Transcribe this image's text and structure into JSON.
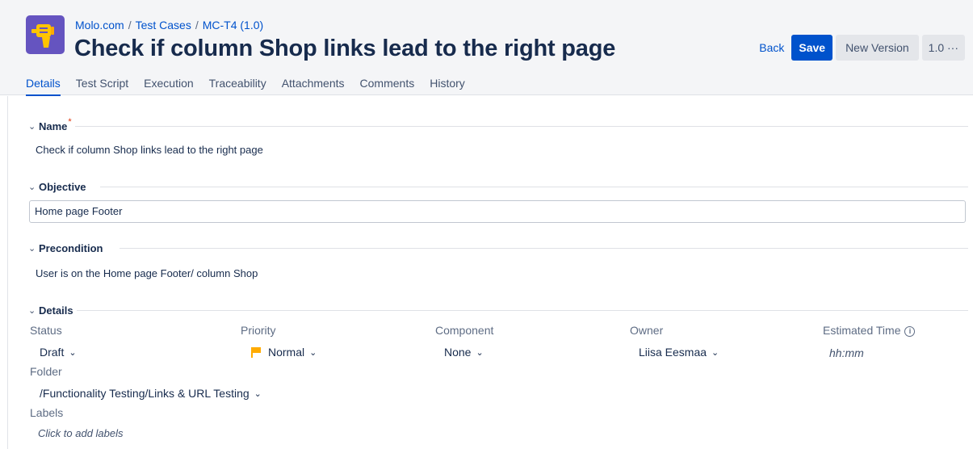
{
  "breadcrumb": {
    "project": "Molo.com",
    "section": "Test Cases",
    "key": "MC-T4 (1.0)",
    "separator": "/"
  },
  "page_title": "Check if column Shop links lead to the right page",
  "actions": {
    "back": "Back",
    "save": "Save",
    "new_version": "New Version",
    "version": "1.0 ···"
  },
  "tabs": [
    {
      "label": "Details",
      "active": true
    },
    {
      "label": "Test Script",
      "active": false
    },
    {
      "label": "Execution",
      "active": false
    },
    {
      "label": "Traceability",
      "active": false
    },
    {
      "label": "Attachments",
      "active": false
    },
    {
      "label": "Comments",
      "active": false
    },
    {
      "label": "History",
      "active": false
    }
  ],
  "sections": {
    "name": {
      "label": "Name",
      "required_marker": "*",
      "value": "Check if column Shop links lead to the right page"
    },
    "objective": {
      "label": "Objective",
      "value": "Home page Footer"
    },
    "precondition": {
      "label": "Precondition",
      "value": "User is on the Home page Footer/ column Shop"
    },
    "details": {
      "label": "Details"
    }
  },
  "details": {
    "status": {
      "label": "Status",
      "value": "Draft"
    },
    "priority": {
      "label": "Priority",
      "value": "Normal"
    },
    "component": {
      "label": "Component",
      "value": "None"
    },
    "owner": {
      "label": "Owner",
      "value": "Liisa Eesmaa"
    },
    "estimated_time": {
      "label": "Estimated Time",
      "placeholder": "hh:mm"
    },
    "folder": {
      "label": "Folder",
      "value": "/Functionality Testing/Links & URL Testing"
    },
    "labels": {
      "label": "Labels",
      "placeholder": "Click to add labels"
    }
  },
  "icons": {
    "chevron": "⌄",
    "caret": "⌄",
    "info": "i"
  },
  "colors": {
    "accent": "#0052cc",
    "app_icon_bg": "#6554c0",
    "app_icon_fg": "#ffc400",
    "priority_flag": "#ffab00",
    "required": "#de350b"
  }
}
